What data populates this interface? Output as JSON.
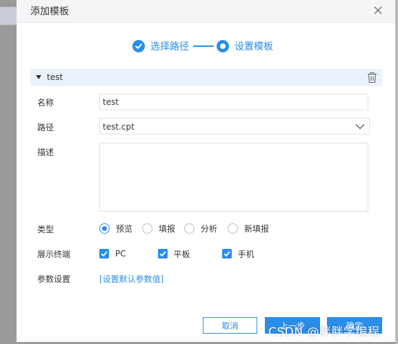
{
  "dialog": {
    "title": "添加模板",
    "close_icon": "close-icon"
  },
  "steps": [
    {
      "label": "选择路径",
      "state": "completed",
      "icon": "check-circle-icon"
    },
    {
      "label": "设置模板",
      "state": "active",
      "icon": "dot-circle-icon"
    }
  ],
  "section": {
    "title": "test",
    "toggle_icon": "caret-down-icon",
    "delete_icon": "trash-icon"
  },
  "form": {
    "name": {
      "label": "名称",
      "value": "test"
    },
    "path": {
      "label": "路径",
      "value": "test.cpt",
      "icon": "chevron-down-icon"
    },
    "description": {
      "label": "描述",
      "value": ""
    },
    "type": {
      "label": "类型",
      "options": [
        {
          "label": "预览",
          "checked": true
        },
        {
          "label": "填报",
          "checked": false
        },
        {
          "label": "分析",
          "checked": false
        },
        {
          "label": "新填报",
          "checked": false
        }
      ]
    },
    "terminals": {
      "label": "展示终端",
      "options": [
        {
          "label": "PC",
          "checked": true
        },
        {
          "label": "平板",
          "checked": true
        },
        {
          "label": "手机",
          "checked": true
        }
      ]
    },
    "params": {
      "label": "参数设置",
      "link": "[设置默认参数值]"
    }
  },
  "buttons": {
    "cancel": "取消",
    "prev": "上一步",
    "ok": "确定"
  },
  "watermark": "CSDN @胖胖学编程",
  "colors": {
    "accent": "#2a8de8",
    "header_bg": "#f4f5f7",
    "section_bg": "#eaf2fc",
    "overlay": "#9a9a9a"
  }
}
